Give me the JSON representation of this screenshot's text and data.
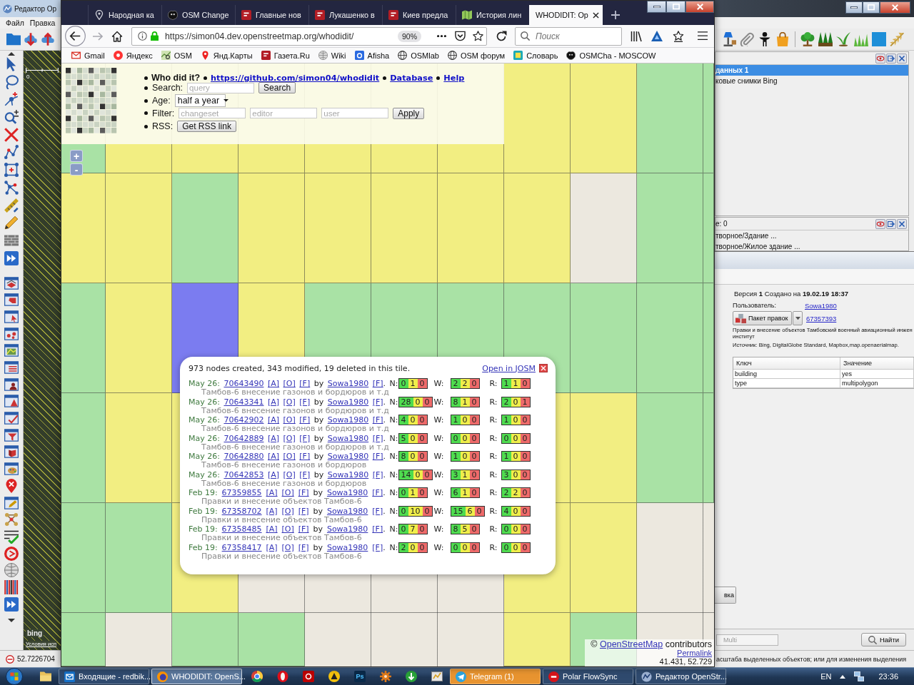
{
  "josm": {
    "title": "Редактор Ор",
    "menu": [
      "Файл",
      "Правка"
    ],
    "scale_label": "0",
    "imagery_logo": "bing",
    "terms_link": "Условия исп",
    "coordinate": "52.7226704",
    "layers": [
      {
        "label": "данных 1",
        "selected": true
      },
      {
        "label": "ковые снимки Bing",
        "selected": false
      }
    ],
    "selection": {
      "title": "е: 0",
      "items": [
        "творное/Здание ...",
        "творное/Жилое здание ..."
      ]
    },
    "history": {
      "version_line": "Версия **1** Создано на **19.02.19 18:37**",
      "user_label": "Пользователь:",
      "user": "Sowa1980",
      "changeset_button": "Пакет правок",
      "changeset": "67357393",
      "comment_lines": [
        "Правки и внесение объектов Тамбовский военный авиационный инжен",
        "институт"
      ],
      "source": "Источник: Bing, DigitalGlobe Standard, Mapbox,map.openaerialmap.",
      "columns": [
        "Ключ",
        "Значение"
      ],
      "tags": [
        [
          "building",
          "yes"
        ],
        [
          "type",
          "multipolygon"
        ]
      ],
      "side_button": "вка"
    },
    "multi_button": {
      "label": "Multi",
      "disabled": true
    },
    "find_button": "Найти",
    "status": "асштаба выделенных объектов; или для изменения выделения"
  },
  "browser": {
    "tabs": [
      {
        "title": "Народная ка",
        "selected": false
      },
      {
        "title": "OSM Change",
        "selected": false
      },
      {
        "title": "Главные нов",
        "selected": false
      },
      {
        "title": "Лукашенко в",
        "selected": false
      },
      {
        "title": "Киев предла",
        "selected": false
      },
      {
        "title": "История лин",
        "selected": false
      },
      {
        "title": "WHODIDIT: Op",
        "selected": true
      }
    ],
    "url": "https://simon04.dev.openstreetmap.org/whodidit/",
    "zoom": "90%",
    "search_placeholder": "Поиск",
    "bookmarks": [
      "Gmail",
      "Яндекс",
      "OSM",
      "Янд.Карты",
      "Газета.Ru",
      "Wiki",
      "Afisha",
      "OSMlab",
      "OSM форум",
      "Словарь",
      "OSMCha - MOSCOW"
    ]
  },
  "whodidit": {
    "title": "Who did it?",
    "links": [
      "https://github.com/simon04/whodidit",
      "Database",
      "Help"
    ],
    "search": {
      "label": "Search:",
      "placeholder": "query",
      "button": "Search"
    },
    "age": {
      "label": "Age:",
      "value": "half a year"
    },
    "filter": {
      "label": "Filter:",
      "placeholders": [
        "changeset",
        "editor",
        "user"
      ],
      "button": "Apply"
    },
    "rss": {
      "label": "RSS:",
      "button": "Get RSS link"
    },
    "zoom_buttons": [
      "+",
      "-"
    ],
    "tiles": [
      [
        {
          "kind": "tile",
          "color": "#a9e2a5"
        },
        {
          "kind": "tile",
          "color": "#f2ee82"
        },
        {
          "kind": "tile",
          "color": "#f2ee82"
        },
        {
          "kind": "tile",
          "color": "#f2ee82"
        },
        {
          "kind": "tile",
          "color": "#f2ee82"
        },
        {
          "kind": "tile",
          "color": "#f2ee82"
        },
        {
          "kind": "tile",
          "color": "#f2ee82"
        },
        {
          "kind": "tile",
          "color": "#f2ee82"
        },
        {
          "kind": "tile",
          "color": "#f2ee82"
        },
        {
          "kind": "tile",
          "color": "#a9e2a5"
        },
        {
          "kind": "tile",
          "color": "#a9e2a5"
        }
      ],
      [
        {
          "kind": "tile",
          "color": "#f2ee82"
        },
        {
          "kind": "tile",
          "color": "#f2ee82"
        },
        {
          "kind": "tile",
          "color": "#a9e2a5"
        },
        {
          "kind": "tile",
          "color": "#f2ee82"
        },
        {
          "kind": "tile",
          "color": "#f2ee82"
        },
        {
          "kind": "tile",
          "color": "#f2ee82"
        },
        {
          "kind": "tile",
          "color": "#f2ee82"
        },
        {
          "kind": "tile",
          "color": "#f2ee82"
        },
        {
          "kind": "blank"
        },
        {
          "kind": "tile",
          "color": "#a9e2a5"
        },
        {
          "kind": "tile",
          "color": "#a9e2a5"
        }
      ],
      [
        {
          "kind": "tile",
          "color": "#a9e2a5"
        },
        {
          "kind": "tile",
          "color": "#f2ee82"
        },
        {
          "kind": "tile",
          "color": "#7b7cf0"
        },
        {
          "kind": "tile",
          "color": "#f2ee82"
        },
        {
          "kind": "tile",
          "color": "#a9e2a5"
        },
        {
          "kind": "tile",
          "color": "#a9e2a5"
        },
        {
          "kind": "tile",
          "color": "#a9e2a5"
        },
        {
          "kind": "tile",
          "color": "#a9e2a5"
        },
        {
          "kind": "tile",
          "color": "#a9e2a5"
        },
        {
          "kind": "tile",
          "color": "#a9e2a5"
        },
        {
          "kind": "tile",
          "color": "#a9e2a5"
        }
      ],
      [
        {
          "kind": "tile",
          "color": "#a9e2a5"
        },
        {
          "kind": "tile",
          "color": "#f2ee82"
        },
        {
          "kind": "tile",
          "color": "#f2ee82"
        },
        {
          "kind": "hidden"
        },
        {
          "kind": "hidden"
        },
        {
          "kind": "hidden"
        },
        {
          "kind": "hidden"
        },
        {
          "kind": "tile",
          "color": "#f2ee82"
        },
        {
          "kind": "tile",
          "color": "#f2ee82"
        },
        {
          "kind": "tile",
          "color": "#a9e2a5"
        },
        {
          "kind": "tile",
          "color": "#a9e2a5"
        }
      ],
      [
        {
          "kind": "tile",
          "color": "#a9e2a5"
        },
        {
          "kind": "tile",
          "color": "#a9e2a5"
        },
        {
          "kind": "tile",
          "color": "#f2ee82"
        },
        {
          "kind": "blank"
        },
        {
          "kind": "blank"
        },
        {
          "kind": "blank"
        },
        {
          "kind": "blank"
        },
        {
          "kind": "tile",
          "color": "#f2ee82"
        },
        {
          "kind": "tile",
          "color": "#f2ee82"
        },
        {
          "kind": "blank"
        },
        {
          "kind": "blank"
        }
      ],
      [
        {
          "kind": "tile",
          "color": "#a9e2a5"
        },
        {
          "kind": "blank"
        },
        {
          "kind": "tile",
          "color": "#a9e2a5"
        },
        {
          "kind": "tile",
          "color": "#a9e2a5"
        },
        {
          "kind": "blank"
        },
        {
          "kind": "blank"
        },
        {
          "kind": "blank"
        },
        {
          "kind": "tile",
          "color": "#f2ee82"
        },
        {
          "kind": "tile",
          "color": "#a9e2a5"
        },
        {
          "kind": "blank"
        },
        {
          "kind": "blank"
        }
      ]
    ],
    "popup": {
      "summary": "973 nodes created, 343 modified, 19 deleted in this tile.",
      "josm_link": "Open in JOSM",
      "rows": [
        {
          "date": "May 26:",
          "changeset": "70643490",
          "links": [
            "[A]",
            "[O]",
            "[F]"
          ],
          "by": "by",
          "user": "Sowa1980",
          "user_link": "[F]",
          "period": ".",
          "counts": [
            {
              "label": "N:",
              "values": [
                "0",
                "1",
                "0"
              ]
            },
            {
              "label": "W:",
              "values": [
                "2",
                "2",
                "0"
              ]
            },
            {
              "label": "R:",
              "values": [
                "1",
                "1",
                "0"
              ]
            }
          ],
          "comment": "Тамбов-6 внесение газонов и бордюров и т.д"
        },
        {
          "date": "May 26:",
          "changeset": "70643341",
          "links": [
            "[A]",
            "[O]",
            "[F]"
          ],
          "by": "by",
          "user": "Sowa1980",
          "user_link": "[F]",
          "period": ".",
          "counts": [
            {
              "label": "N:",
              "values": [
                "28",
                "0",
                "0"
              ]
            },
            {
              "label": "W:",
              "values": [
                "8",
                "1",
                "0"
              ]
            },
            {
              "label": "R:",
              "values": [
                "2",
                "0",
                "1"
              ]
            }
          ],
          "comment": "Тамбов-6 внесение газонов и бордюров и т.д"
        },
        {
          "date": "May 26:",
          "changeset": "70642902",
          "links": [
            "[A]",
            "[O]",
            "[F]"
          ],
          "by": "by",
          "user": "Sowa1980",
          "user_link": "[F]",
          "period": ".",
          "counts": [
            {
              "label": "N:",
              "values": [
                "4",
                "0",
                "0"
              ]
            },
            {
              "label": "W:",
              "values": [
                "1",
                "0",
                "0"
              ]
            },
            {
              "label": "R:",
              "values": [
                "1",
                "0",
                "0"
              ]
            }
          ],
          "comment": "Тамбов-6 внесение газонов и бордюров и т.д"
        },
        {
          "date": "May 26:",
          "changeset": "70642889",
          "links": [
            "[A]",
            "[O]",
            "[F]"
          ],
          "by": "by",
          "user": "Sowa1980",
          "user_link": "[F]",
          "period": ".",
          "counts": [
            {
              "label": "N:",
              "values": [
                "5",
                "0",
                "0"
              ]
            },
            {
              "label": "W:",
              "values": [
                "0",
                "0",
                "0"
              ]
            },
            {
              "label": "R:",
              "values": [
                "0",
                "0",
                "0"
              ]
            }
          ],
          "comment": "Тамбов-6 внесение газонов и бордюров и т.д"
        },
        {
          "date": "May 26:",
          "changeset": "70642880",
          "links": [
            "[A]",
            "[O]",
            "[F]"
          ],
          "by": "by",
          "user": "Sowa1980",
          "user_link": "[F]",
          "period": ".",
          "counts": [
            {
              "label": "N:",
              "values": [
                "8",
                "0",
                "0"
              ]
            },
            {
              "label": "W:",
              "values": [
                "1",
                "0",
                "0"
              ]
            },
            {
              "label": "R:",
              "values": [
                "1",
                "0",
                "0"
              ]
            }
          ],
          "comment": "Тамбов-6 внесение газонов и бордюров"
        },
        {
          "date": "May 26:",
          "changeset": "70642853",
          "links": [
            "[A]",
            "[O]",
            "[F]"
          ],
          "by": "by",
          "user": "Sowa1980",
          "user_link": "[F]",
          "period": ".",
          "counts": [
            {
              "label": "N:",
              "values": [
                "14",
                "0",
                "0"
              ]
            },
            {
              "label": "W:",
              "values": [
                "3",
                "1",
                "0"
              ]
            },
            {
              "label": "R:",
              "values": [
                "3",
                "0",
                "0"
              ]
            }
          ],
          "comment": "Тамбов-6 внесение газонов и бордюров"
        },
        {
          "date": "Feb 19:",
          "changeset": "67359855",
          "links": [
            "[A]",
            "[O]",
            "[F]"
          ],
          "by": "by",
          "user": "Sowa1980",
          "user_link": "[F]",
          "period": ".",
          "counts": [
            {
              "label": "N:",
              "values": [
                "0",
                "1",
                "0"
              ]
            },
            {
              "label": "W:",
              "values": [
                "6",
                "1",
                "0"
              ]
            },
            {
              "label": "R:",
              "values": [
                "2",
                "2",
                "0"
              ]
            }
          ],
          "comment": "Правки и внесение объектов Тамбов-6"
        },
        {
          "date": "Feb 19:",
          "changeset": "67358702",
          "links": [
            "[A]",
            "[O]",
            "[F]"
          ],
          "by": "by",
          "user": "Sowa1980",
          "user_link": "[F]",
          "period": ".",
          "counts": [
            {
              "label": "N:",
              "values": [
                "0",
                "10",
                "0"
              ]
            },
            {
              "label": "W:",
              "values": [
                "15",
                "6",
                "0"
              ]
            },
            {
              "label": "R:",
              "values": [
                "4",
                "0",
                "0"
              ]
            }
          ],
          "comment": "Правки и внесение объектов Тамбов-6"
        },
        {
          "date": "Feb 19:",
          "changeset": "67358485",
          "links": [
            "[A]",
            "[O]",
            "[F]"
          ],
          "by": "by",
          "user": "Sowa1980",
          "user_link": "[F]",
          "period": ".",
          "counts": [
            {
              "label": "N:",
              "values": [
                "0",
                "7",
                "0"
              ]
            },
            {
              "label": "W:",
              "values": [
                "8",
                "5",
                "0"
              ]
            },
            {
              "label": "R:",
              "values": [
                "0",
                "0",
                "0"
              ]
            }
          ],
          "comment": "Правки и внесение объектов Тамбов-6"
        },
        {
          "date": "Feb 19:",
          "changeset": "67358417",
          "links": [
            "[A]",
            "[O]",
            "[F]"
          ],
          "by": "by",
          "user": "Sowa1980",
          "user_link": "[F]",
          "period": ".",
          "counts": [
            {
              "label": "N:",
              "values": [
                "2",
                "0",
                "0"
              ]
            },
            {
              "label": "W:",
              "values": [
                "0",
                "0",
                "0"
              ]
            },
            {
              "label": "R:",
              "values": [
                "0",
                "0",
                "0"
              ]
            }
          ],
          "comment": "Правки и внесение объектов Тамбов-6"
        }
      ]
    },
    "attribution": {
      "text_before": "©",
      "link": "OpenStreetMap",
      "text_after": "contributors",
      "permalink": "Permalink",
      "coords": "41.431, 52.729"
    }
  },
  "taskbar": {
    "items": [
      {
        "kind": "pinned"
      },
      {
        "kind": "window",
        "label": "Входящие - redbik...",
        "selected": false,
        "attention": false
      },
      {
        "kind": "window",
        "label": "WHODIDIT: OpenS...",
        "selected": true,
        "attention": false
      },
      {
        "kind": "pinned"
      },
      {
        "kind": "pinned"
      },
      {
        "kind": "pinned"
      },
      {
        "kind": "pinned"
      },
      {
        "kind": "pinned",
        "label": "Ps"
      },
      {
        "kind": "pinned"
      },
      {
        "kind": "pinned"
      },
      {
        "kind": "pinned"
      },
      {
        "kind": "window",
        "label": "Telegram (1)",
        "selected": false,
        "attention": true
      },
      {
        "kind": "window",
        "label": "Polar FlowSync",
        "selected": false,
        "attention": false
      },
      {
        "kind": "window",
        "label": "Редактор OpenStr...",
        "selected": false,
        "attention": false
      }
    ],
    "language": "EN",
    "clock": "23:36"
  }
}
